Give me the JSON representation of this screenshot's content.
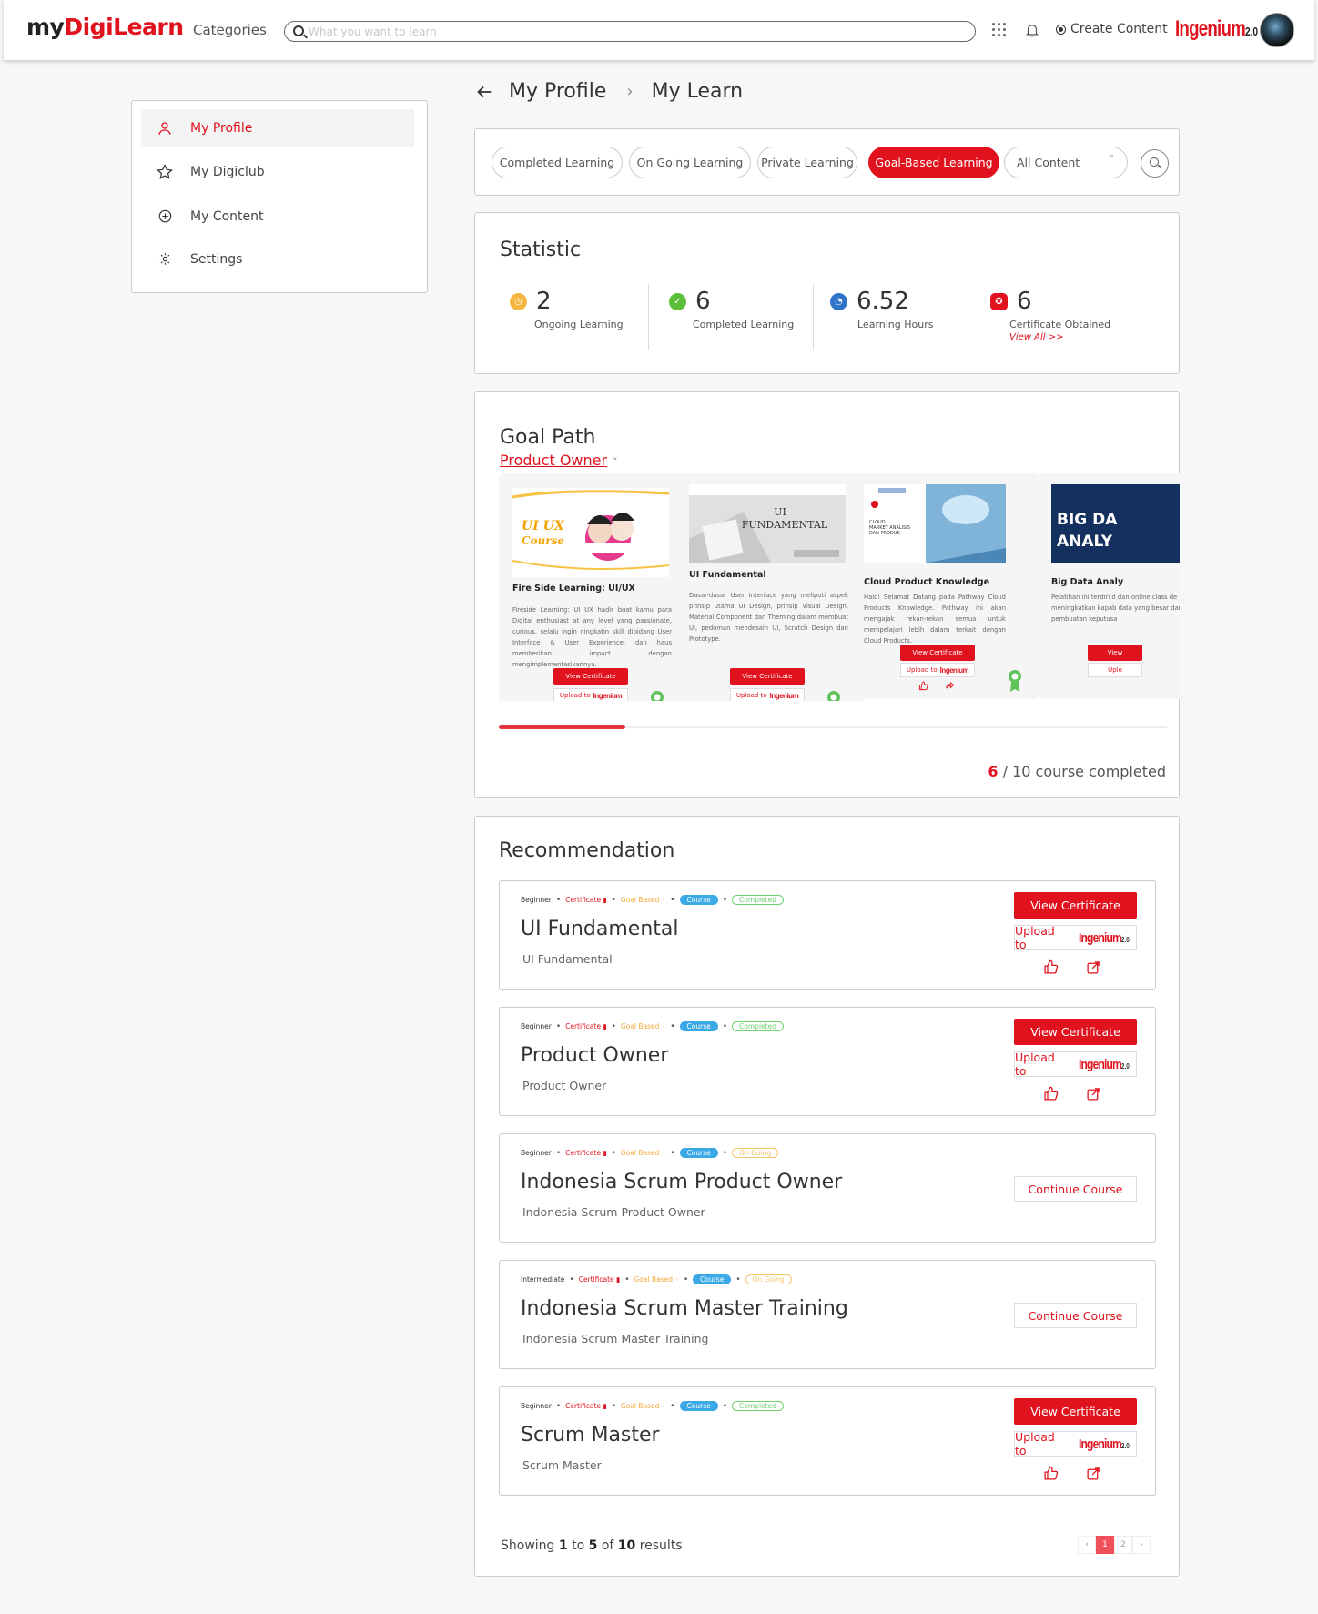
{
  "header": {
    "logo_prefix": "my",
    "logo_brand": "DigiLearn",
    "categories_label": "Categories",
    "search_placeholder": "What you want to learn",
    "create_label": "Create Content",
    "ingenium_logo": "Ingenium",
    "ingenium_version": "2.0"
  },
  "sidebar": {
    "items": [
      {
        "label": "My Profile",
        "icon": "user-icon",
        "active": true
      },
      {
        "label": "My Digiclub",
        "icon": "star-icon"
      },
      {
        "label": "My Content",
        "icon": "plus-circle-icon"
      },
      {
        "label": "Settings",
        "icon": "gear-icon"
      }
    ]
  },
  "breadcrumb": {
    "root": "My Profile",
    "current": "My Learn"
  },
  "filters": {
    "tabs": [
      "Completed Learning",
      "On Going Learning",
      "Private Learning",
      "Goal-Based Learning"
    ],
    "active_tab": "Goal-Based Learning",
    "content_select": "All Content"
  },
  "statistic": {
    "title": "Statistic",
    "items": [
      {
        "value": "2",
        "label": "Ongoing Learning",
        "color": "#f4b63e"
      },
      {
        "value": "6",
        "label": "Completed Learning",
        "color": "#5cbf3a"
      },
      {
        "value": "6.52",
        "label": "Learning Hours",
        "color": "#2f73c9"
      },
      {
        "value": "6",
        "label": "Certificate Obtained",
        "color": "#e0121e",
        "link": "View All >>"
      }
    ]
  },
  "goal_path": {
    "title": "Goal Path",
    "selected_goal": "Product Owner",
    "cards": [
      {
        "title": "Fire Side Learning: UI/UX",
        "thumb_text": "UI UX Course",
        "description": "Fireside Learning: UI UX hadir buat kamu para Digital enthusiast at any level yang passionate, curious, selalu ingin ningkatin skill dibidang User Interface & User Experience, dan haus memberikan impact dengan mengimplementasikannya.",
        "button": "View Certificate",
        "upload": "Upload to"
      },
      {
        "title": "UI Fundamental",
        "thumb_text": "UI FUNDAMENTAL",
        "description": "Dasar-dasar User Interface yang meliputi aspek prinsip utama UI Design, prinsip Visual Design, Material Component dan Theming dalam membuat UI, pedoman mendesain UI, Scratch Design dan Prototype.",
        "button": "View Certificate",
        "upload": "Upload to"
      },
      {
        "title": "Cloud Product Knowledge",
        "thumb_text": "CLOUD MARKET ANALISIS DAN PRODUK",
        "description": "Halo! Selamat Datang pada Pathway Cloud Products Knowledge. Pathway ini akan mengajak rekan-rekan semua untuk mempelajari lebih dalam terkait dengan Cloud Products.",
        "button": "View Certificate",
        "upload": "Upload to"
      },
      {
        "title": "Big Data Analy",
        "thumb_text": "BIG DA ANALY",
        "description": "Pelatihan ini terdiri d dan online class de meningkatkan kapab data yang besar dan pembuatan keputusa",
        "button": "View",
        "upload": "Uplo"
      }
    ],
    "progress_fraction": 0.19,
    "completed_count": "6",
    "completed_text": "/ 10 course completed"
  },
  "recommendation": {
    "title": "Recommendation",
    "tags": {
      "cert": "Certificate",
      "goal": "Goal Based",
      "course": "Course",
      "completed": "Completed",
      "ongoing": "On Going"
    },
    "items": [
      {
        "level": "Beginner",
        "title": "UI Fundamental",
        "subtitle": "UI Fundamental",
        "status": "completed",
        "primary": "View Certificate",
        "upload": "Upload to"
      },
      {
        "level": "Beginner",
        "title": "Product Owner",
        "subtitle": "Product Owner",
        "status": "completed",
        "primary": "View Certificate",
        "upload": "Upload to"
      },
      {
        "level": "Beginner",
        "title": "Indonesia Scrum Product Owner",
        "subtitle": "Indonesia Scrum Product Owner",
        "status": "ongoing",
        "continue": "Continue Course"
      },
      {
        "level": "Intermediate",
        "title": "Indonesia Scrum Master Training",
        "subtitle": "Indonesia Scrum Master Training",
        "status": "ongoing",
        "continue": "Continue Course"
      },
      {
        "level": "Beginner",
        "title": "Scrum Master",
        "subtitle": "Scrum Master",
        "status": "completed",
        "primary": "View Certificate",
        "upload": "Upload to"
      }
    ]
  },
  "pagination": {
    "showing_prefix": "Showing",
    "from": "1",
    "to_word": "to",
    "to": "5",
    "of_word": "of",
    "total": "10",
    "results_word": "results",
    "prev": "‹",
    "pages": [
      "1",
      "2"
    ],
    "next": "›"
  }
}
